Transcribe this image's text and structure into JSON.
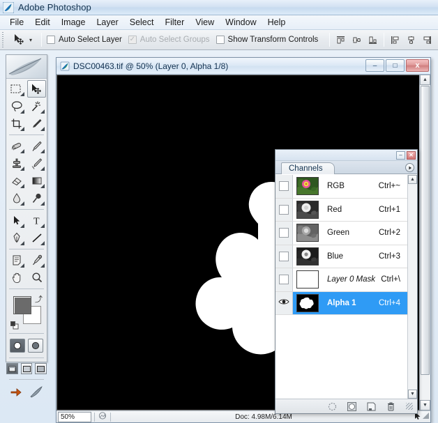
{
  "app": {
    "title": "Adobe Photoshop",
    "logo_icon": "photoshop-feather-icon"
  },
  "menubar": {
    "items": [
      {
        "label": "File"
      },
      {
        "label": "Edit"
      },
      {
        "label": "Image"
      },
      {
        "label": "Layer"
      },
      {
        "label": "Select"
      },
      {
        "label": "Filter"
      },
      {
        "label": "View"
      },
      {
        "label": "Window"
      },
      {
        "label": "Help"
      }
    ]
  },
  "options_bar": {
    "active_tool_icon": "move-tool-icon",
    "tool_preset_caret": "▾",
    "checkboxes": [
      {
        "label": "Auto Select Layer",
        "checked": false,
        "disabled": false
      },
      {
        "label": "Auto Select Groups",
        "checked": true,
        "disabled": true
      },
      {
        "label": "Show Transform Controls",
        "checked": false,
        "disabled": false
      }
    ],
    "align_icons_group1": [
      "align-top-edges-icon",
      "align-vertical-centers-icon",
      "align-bottom-edges-icon"
    ],
    "align_icons_group2": [
      "align-left-edges-icon",
      "align-horizontal-centers-icon",
      "align-right-edges-icon"
    ],
    "align_icons_group3": [
      "distribute-top-edges-icon",
      "distribute-vertical-centers-icon",
      "distribute-bottom-edges-icon"
    ]
  },
  "toolbox": {
    "tools": [
      {
        "name": "rectangular-marquee-tool",
        "selected": false,
        "has_flyout": true
      },
      {
        "name": "move-tool",
        "selected": true,
        "has_flyout": false
      },
      {
        "name": "lasso-tool",
        "selected": false,
        "has_flyout": true
      },
      {
        "name": "magic-wand-tool",
        "selected": false,
        "has_flyout": true
      },
      {
        "name": "crop-tool",
        "selected": false,
        "has_flyout": true
      },
      {
        "name": "slice-tool",
        "selected": false,
        "has_flyout": true
      },
      {
        "name": "healing-brush-tool",
        "selected": false,
        "has_flyout": true
      },
      {
        "name": "brush-tool",
        "selected": false,
        "has_flyout": true
      },
      {
        "name": "clone-stamp-tool",
        "selected": false,
        "has_flyout": true
      },
      {
        "name": "history-brush-tool",
        "selected": false,
        "has_flyout": true
      },
      {
        "name": "eraser-tool",
        "selected": false,
        "has_flyout": true
      },
      {
        "name": "gradient-tool",
        "selected": false,
        "has_flyout": true
      },
      {
        "name": "blur-tool",
        "selected": false,
        "has_flyout": true
      },
      {
        "name": "dodge-tool",
        "selected": false,
        "has_flyout": true
      },
      {
        "name": "path-selection-tool",
        "selected": false,
        "has_flyout": true
      },
      {
        "name": "type-tool",
        "selected": false,
        "has_flyout": true
      },
      {
        "name": "pen-tool",
        "selected": false,
        "has_flyout": true
      },
      {
        "name": "line-tool",
        "selected": false,
        "has_flyout": true
      },
      {
        "name": "notes-tool",
        "selected": false,
        "has_flyout": true
      },
      {
        "name": "eyedropper-tool",
        "selected": false,
        "has_flyout": true
      },
      {
        "name": "hand-tool",
        "selected": false,
        "has_flyout": false
      },
      {
        "name": "zoom-tool",
        "selected": false,
        "has_flyout": false
      }
    ],
    "foreground_color": "#6b6b6b",
    "background_color": "#ffffff",
    "swap_colors_icon": "swap-colors-icon",
    "default_colors_icon": "default-colors-icon",
    "mask_modes": [
      "standard-mask-mode",
      "quick-mask-mode"
    ],
    "screen_modes": [
      "standard-screen-mode",
      "full-screen-menubar-mode",
      "full-screen-mode"
    ],
    "jump_to_imageready_icon": "jump-to-imageready-icon"
  },
  "document": {
    "icon": "document-icon",
    "title": "DSC00463.tif @ 50% (Layer 0, Alpha 1/8)",
    "window_buttons": {
      "minimize": "–",
      "maximize": "□",
      "close": "x"
    },
    "canvas": {
      "background_color": "#000000",
      "shape_color": "#ffffff",
      "shape_description": "white-flower-silhouette-mask"
    },
    "status": {
      "zoom_level": "50%",
      "doc_info": "Doc: 4.98M/6.14M"
    },
    "scrollbars": {
      "vertical_up_arrow": "▲",
      "vertical_down_arrow": "▼",
      "horizontal_left_arrow": "◄",
      "horizontal_right_arrow": "►"
    }
  },
  "channels_panel": {
    "titlebar_buttons": {
      "minimize": "–",
      "close": "✕"
    },
    "tab_label": "Channels",
    "menu_button_icon": "panel-menu-icon",
    "rows": [
      {
        "name": "RGB",
        "shortcut": "Ctrl+~",
        "visible": false,
        "selected": false,
        "italic": false,
        "thumb": "rgb-composite-thumbnail"
      },
      {
        "name": "Red",
        "shortcut": "Ctrl+1",
        "visible": false,
        "selected": false,
        "italic": false,
        "thumb": "red-channel-thumbnail"
      },
      {
        "name": "Green",
        "shortcut": "Ctrl+2",
        "visible": false,
        "selected": false,
        "italic": false,
        "thumb": "green-channel-thumbnail"
      },
      {
        "name": "Blue",
        "shortcut": "Ctrl+3",
        "visible": false,
        "selected": false,
        "italic": false,
        "thumb": "blue-channel-thumbnail"
      },
      {
        "name": "Layer 0 Mask",
        "shortcut": "Ctrl+\\",
        "visible": false,
        "selected": false,
        "italic": true,
        "thumb": "layer-mask-thumbnail"
      },
      {
        "name": "Alpha 1",
        "shortcut": "Ctrl+4",
        "visible": true,
        "selected": true,
        "italic": false,
        "thumb": "alpha-1-thumbnail"
      }
    ],
    "footer_buttons": [
      "load-channel-as-selection-icon",
      "save-selection-as-channel-icon",
      "create-new-channel-icon",
      "delete-channel-icon"
    ],
    "selection_highlight_color": "#2f9bf5"
  }
}
